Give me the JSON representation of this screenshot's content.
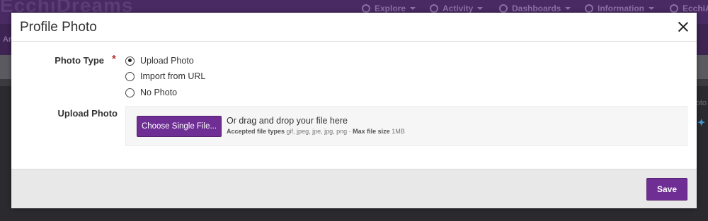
{
  "background": {
    "logo_text": "EcchiDreams",
    "menu": [
      {
        "label": "Explore"
      },
      {
        "label": "Activity"
      },
      {
        "label": "Dashboards"
      },
      {
        "label": "Information"
      },
      {
        "label": "EcchiAI"
      }
    ],
    "sub_text": "An",
    "right_text": "oto"
  },
  "dialog": {
    "title": "Profile Photo",
    "photo_type_label": "Photo Type",
    "required_mark": "*",
    "options": [
      {
        "label": "Upload Photo",
        "checked": true
      },
      {
        "label": "Import from URL",
        "checked": false
      },
      {
        "label": "No Photo",
        "checked": false
      }
    ],
    "upload_label": "Upload Photo",
    "choose_button": "Choose Single File...",
    "drag_text": "Or drag and drop your file here",
    "accepted_label": "Accepted file types",
    "accepted_types": "gif, jpeg, jpe, jpg, png",
    "separator": "·",
    "max_size_label": "Max file size",
    "max_size": "1MB",
    "save_button": "Save"
  },
  "colors": {
    "accent": "#6e2e94",
    "required": "#b33030"
  }
}
